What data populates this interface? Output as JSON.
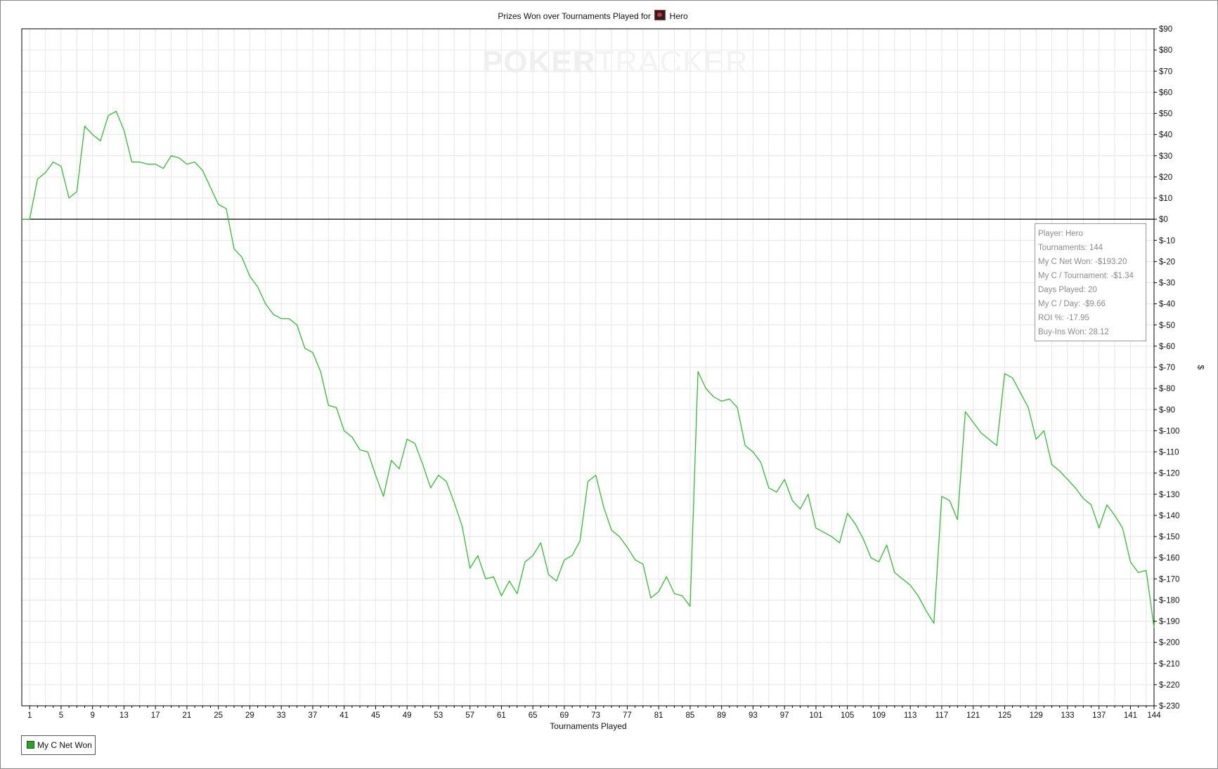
{
  "title_prefix": "Prizes Won over Tournaments Played for",
  "player_name": "Hero",
  "site_icon": "poker-site-icon",
  "watermark": {
    "part1": "POKER",
    "part2": "TRACKER"
  },
  "colors": {
    "series": "#2fbf2f",
    "grid": "#e6e6e6",
    "zero_line": "#000000"
  },
  "info": {
    "player": "Player: Hero",
    "tournaments": "Tournaments: 144",
    "net_won": "My C Net Won: -$193.20",
    "per_tournament": "My C / Tournament: -$1.34",
    "days_played": "Days Played: 20",
    "per_day": "My C / Day: -$9.66",
    "roi": "ROI %: -17.95",
    "buyins_won": "Buy-Ins Won: 28.12"
  },
  "chart_data": {
    "type": "line",
    "title": "Prizes Won over Tournaments Played for Hero",
    "xlabel": "Tournaments Played",
    "ylabel": "$",
    "xlim": [
      0,
      144
    ],
    "ylim": [
      -230,
      90
    ],
    "grid": true,
    "legend": "bottom-left",
    "x_ticks": [
      1,
      5,
      9,
      13,
      17,
      21,
      25,
      29,
      33,
      37,
      41,
      45,
      49,
      53,
      57,
      61,
      65,
      69,
      73,
      77,
      81,
      85,
      89,
      93,
      97,
      101,
      105,
      109,
      113,
      117,
      121,
      125,
      129,
      133,
      137,
      141,
      144
    ],
    "y_ticks": [
      90,
      80,
      70,
      60,
      50,
      40,
      30,
      20,
      10,
      0,
      -10,
      -20,
      -30,
      -40,
      -50,
      -60,
      -70,
      -80,
      -90,
      -100,
      -110,
      -120,
      -130,
      -140,
      -150,
      -160,
      -170,
      -180,
      -190,
      -200,
      -210,
      -220,
      -230
    ],
    "y_tick_labels": [
      "$90",
      "$80",
      "$70",
      "$60",
      "$50",
      "$40",
      "$30",
      "$20",
      "$10",
      "$0",
      "$-10",
      "$-20",
      "$-30",
      "$-40",
      "$-50",
      "$-60",
      "$-70",
      "$-80",
      "$-90",
      "$-100",
      "$-110",
      "$-120",
      "$-130",
      "$-140",
      "$-150",
      "$-160",
      "$-170",
      "$-180",
      "$-190",
      "$-200",
      "$-210",
      "$-220",
      "$-230"
    ],
    "series": [
      {
        "name": "My C Net Won",
        "values": [
          0,
          0,
          19,
          22,
          27,
          25,
          10,
          13,
          44,
          40,
          37,
          49,
          51,
          42,
          27,
          27,
          26,
          26,
          24,
          30,
          29,
          26,
          27,
          23,
          15,
          7,
          5,
          -14,
          -18,
          -27,
          -32,
          -40,
          -45,
          -47,
          -47,
          -50,
          -61,
          -63,
          -72,
          -88,
          -89,
          -100,
          -103,
          -109,
          -110,
          -121,
          -131,
          -114,
          -118,
          -104,
          -106,
          -116,
          -127,
          -121,
          -124,
          -134,
          -145,
          -165,
          -159,
          -170,
          -169,
          -178,
          -171,
          -177,
          -162,
          -159,
          -153,
          -168,
          -171,
          -161,
          -159,
          -152,
          -124,
          -121,
          -136,
          -147,
          -150,
          -155,
          -161,
          -163,
          -179,
          -176,
          -169,
          -177,
          -178,
          -183,
          -72,
          -80,
          -84,
          -86,
          -85,
          -89,
          -107,
          -110,
          -115,
          -127,
          -129,
          -123,
          -133,
          -137,
          -130,
          -146,
          -148,
          -150,
          -153,
          -139,
          -144,
          -151,
          -160,
          -162,
          -154,
          -167,
          -170,
          -173,
          -178,
          -185,
          -191,
          -131,
          -133,
          -142,
          -91,
          -96,
          -101,
          -104,
          -107,
          -73,
          -75,
          -82,
          -89,
          -104,
          -100,
          -116,
          -119,
          -123,
          -127,
          -132,
          -135,
          -146,
          -135,
          -140,
          -146,
          -162,
          -167,
          -166,
          -193
        ]
      }
    ]
  }
}
